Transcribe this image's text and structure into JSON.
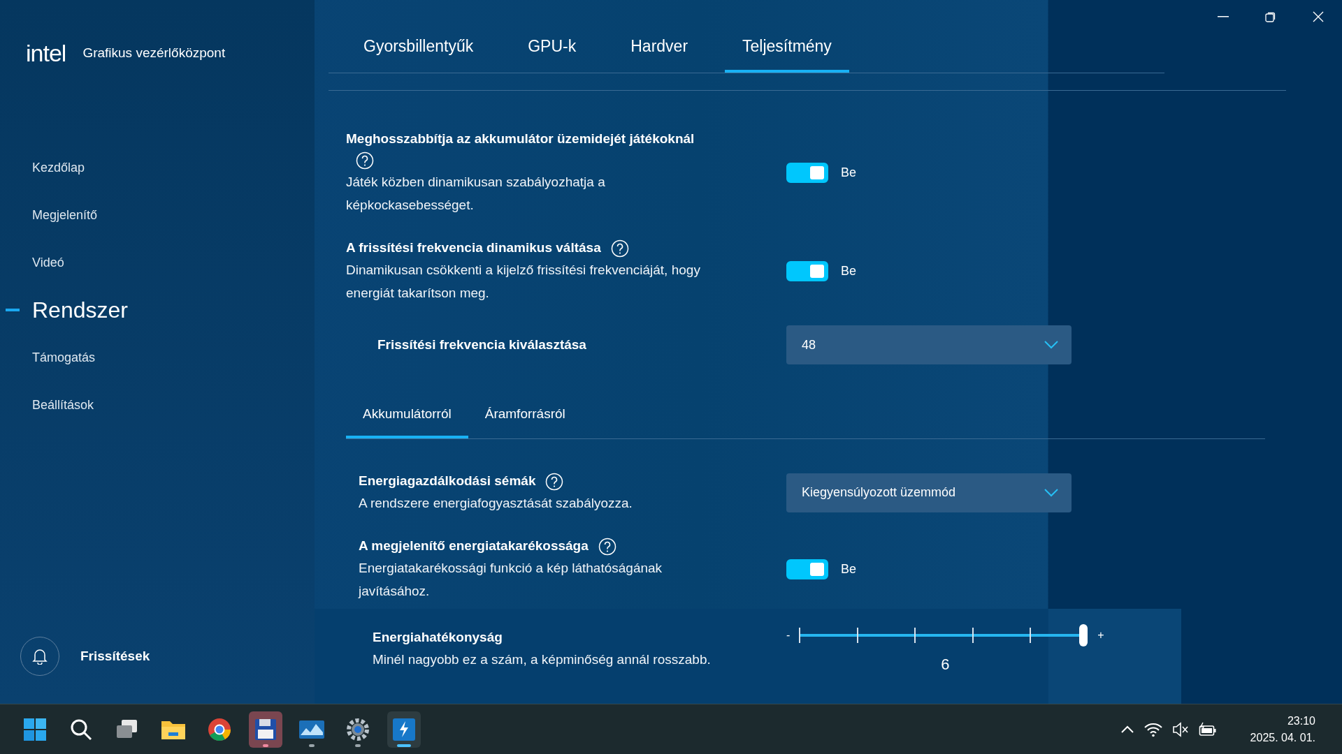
{
  "app": {
    "logo": "intel",
    "title": "Grafikus vezérlőközpont"
  },
  "sidebar": {
    "items": [
      {
        "label": "Kezdőlap",
        "selected": false
      },
      {
        "label": "Megjelenítő",
        "selected": false
      },
      {
        "label": "Videó",
        "selected": false
      },
      {
        "label": "Rendszer",
        "selected": true
      },
      {
        "label": "Támogatás",
        "selected": false
      },
      {
        "label": "Beállítások",
        "selected": false
      }
    ]
  },
  "notifications": {
    "label": "Frissítések"
  },
  "tabs": [
    {
      "label": "Gyorsbillentyűk",
      "selected": false
    },
    {
      "label": "GPU-k",
      "selected": false
    },
    {
      "label": "Hardver",
      "selected": false
    },
    {
      "label": "Teljesítmény",
      "selected": true
    }
  ],
  "settings": [
    {
      "kind": "toggle",
      "title": "Meghosszabbítja az akkumulátor üzemidejét játékoknál",
      "help": true,
      "description": "Játék közben dinamikusan szabályozhatja a képkockasebességet.",
      "on": true,
      "state_label": "Be"
    },
    {
      "kind": "toggle",
      "title": "A frissítési frekvencia dinamikus váltása",
      "help": true,
      "description": "Dinamikusan csökkenti a kijelző frissítési frekvenciáját, hogy energiát takarítson meg.",
      "on": true,
      "state_label": "Be"
    },
    {
      "kind": "dropdown",
      "title": "Frissítési frekvencia kiválasztása",
      "value": "48"
    }
  ],
  "subtabs": [
    {
      "label": "Akkumulátorról",
      "selected": true
    },
    {
      "label": "Áramforrásról",
      "selected": false
    }
  ],
  "power_settings": [
    {
      "kind": "dropdown",
      "title": "Energiagazdálkodási sémák",
      "help": true,
      "description": "A rendszere energiafogyasztását szabályozza.",
      "value": "Kiegyensúlyozott üzemmód"
    },
    {
      "kind": "toggle",
      "title": "A megjelenítő energiatakarékossága",
      "help": true,
      "description": "Energiatakarékossági funkció a kép láthatóságának javításához.",
      "on": true,
      "state_label": "Be"
    },
    {
      "kind": "slider",
      "title": "Energiahatékonyság",
      "description": "Minél nagyobb ez a szám, a képminőség annál rosszabb.",
      "min_label": "-",
      "max_label": "+",
      "level": 1,
      "reading": "6"
    }
  ],
  "taskbar": {
    "time": "23:10",
    "date": "2025. 04. 01."
  }
}
